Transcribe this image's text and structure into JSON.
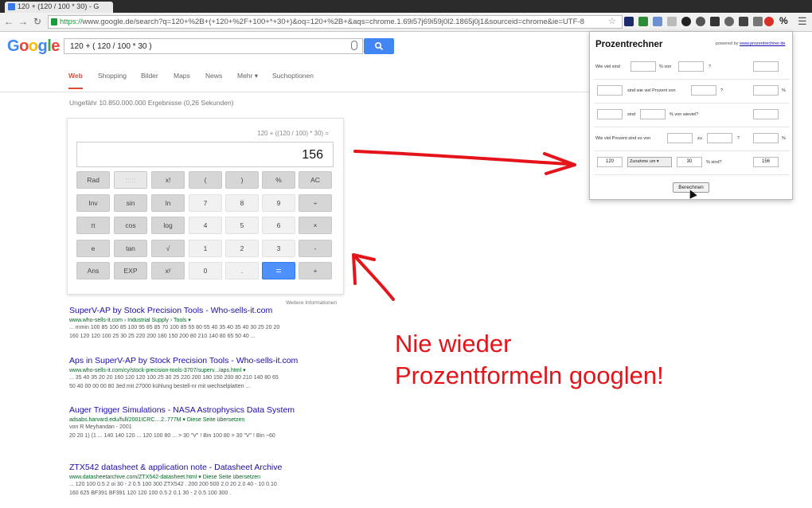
{
  "browser": {
    "tab_title": "120 + (120 / 100 * 30) - G",
    "url_scheme": "https://",
    "url_rest": "www.google.de/search?q=120+%2B+(+120+%2F+100+*+30+)&oq=120+%2B+&aqs=chrome.1.69i57j69i59j0l2.1865j0j1&sourceid=chrome&ie=UTF-8",
    "ext_percent_label": "%",
    "colors": {
      "accent": "#4285f4",
      "red": "#e4141a"
    }
  },
  "google": {
    "logo_letters": [
      {
        "ch": "G",
        "color": "#4285f4"
      },
      {
        "ch": "o",
        "color": "#ea4335"
      },
      {
        "ch": "o",
        "color": "#fbbc05"
      },
      {
        "ch": "g",
        "color": "#4285f4"
      },
      {
        "ch": "l",
        "color": "#34a853"
      },
      {
        "ch": "e",
        "color": "#ea4335"
      }
    ],
    "query": "120 + ( 120 / 100 * 30 )",
    "tabs": [
      "Web",
      "Shopping",
      "Bilder",
      "Maps",
      "News",
      "Mehr ▾",
      "Suchoptionen"
    ],
    "result_stats": "Ungefähr 10.850.000.000 Ergebnisse (0,26 Sekunden)"
  },
  "calculator": {
    "expression": "120 + ((120 / 100) * 30) =",
    "display": "156",
    "more_info": "Weitere Informationen",
    "keys": [
      [
        "Rad",
        ":::::",
        "x!",
        "(",
        ")",
        "%",
        "AC"
      ],
      [
        "Inv",
        "sin",
        "ln",
        "7",
        "8",
        "9",
        "÷"
      ],
      [
        "π",
        "cos",
        "log",
        "4",
        "5",
        "6",
        "×"
      ],
      [
        "e",
        "tan",
        "√",
        "1",
        "2",
        "3",
        "-"
      ],
      [
        "Ans",
        "EXP",
        "xʸ",
        "0",
        ".",
        "=",
        "+"
      ]
    ]
  },
  "results": [
    {
      "title": "SuperV-AP by Stock Precision Tools - Who-sells-it.com",
      "url": "www.who-sells-it.com › Industrial Supply › Tools ▾",
      "snippet1": "... mmin 100 85 100 85 100 95 85 85 70 100 85 55 80 55 40 35 40 35 40 30 25 20 20",
      "snippet2": "160 120 120 100 25 30 25 220 200 180 150 200 80 210 140 80 65 50 40 ..."
    },
    {
      "title": "Aps in SuperV-AP by Stock Precision Tools - Who-sells-it.com",
      "url": "www.who-sells-it.com/cy/stock-precision-tools-3707/superv.../aps.html ▾",
      "snippet1": "... 35 40 35 20 20 160 120 120 100 25 30 25 220 200 180 150 200 80 210 140 80 65",
      "snippet2": "50 40 00 00 00 80 3ed mit 27000 kühlung bestell-nr mit wechselplatten ..."
    },
    {
      "title": "Auger Trigger Simulations - NASA Astrophysics Data System",
      "url": "adsabs.harvard.edu/full/2001ICRC....2..777M ▾ Diese Seite übersetzen",
      "snippet1": "von R Meyhandan - 2001",
      "snippet2": "20 20 1) (1 ... 140 140 120 ... 120 100 80 ... > 30 \"V\" ! Bin 100 80 > 30 \"V\" ! Bin ~60"
    },
    {
      "title": "ZTX542 datasheet & application note - Datasheet Archive",
      "url": "www.datasheetarchive.com/ZTX542-datasheet.html ▾ Diese Seite übersetzen",
      "snippet1": "... 120 100 0.5 2 oi 30 - 2 0.5 100 300 ZTX542 . 200 200 500 2.0 20 2.0 40 - 10 0.10",
      "snippet2": "160 625 BF391 BF391 120 120 100 0.5 2 0.1 30 - 2 0.5 100 300 ."
    }
  ],
  "popup": {
    "title": "Prozentrechner",
    "powered_prefix": "powered by",
    "powered_link": "www.prozentrechner.de",
    "row1": {
      "a": "Wie viel sind",
      "b": "% von",
      "c": "?"
    },
    "row2": {
      "a": "sind wie viel Prozent von",
      "b": "?",
      "c": "%"
    },
    "row3": {
      "a": "sind",
      "b": "% von wieviel?"
    },
    "row4": {
      "a": "Wie viel Prozent sind es von",
      "b": "zu",
      "c": "?",
      "d": "%"
    },
    "row5": {
      "v1": "120",
      "select": "Zunahme um ▾",
      "v2": "30",
      "label": "% sind?",
      "result": "156"
    },
    "button": "Berechnen"
  },
  "annotation": {
    "line1": "Nie wieder",
    "line2": "Prozentformeln googlen!"
  }
}
